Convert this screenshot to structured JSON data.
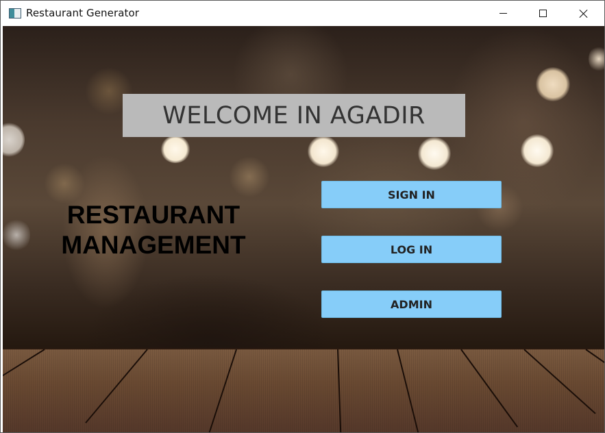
{
  "window": {
    "title": "Restaurant Generator",
    "icon": "app-window-icon",
    "controls": {
      "minimize": "minimize-icon",
      "maximize": "maximize-icon",
      "close": "close-icon"
    }
  },
  "main": {
    "welcome": "WELCOME IN AGADIR",
    "heading_line1": "RESTAURANT",
    "heading_line2": "MANAGEMENT",
    "buttons": {
      "sign_in": "SIGN IN",
      "log_in": "LOG IN",
      "admin": "ADMIN"
    }
  },
  "colors": {
    "button_bg": "#86cdf9",
    "welcome_bg": "#bababa",
    "title_text": "#000000"
  }
}
